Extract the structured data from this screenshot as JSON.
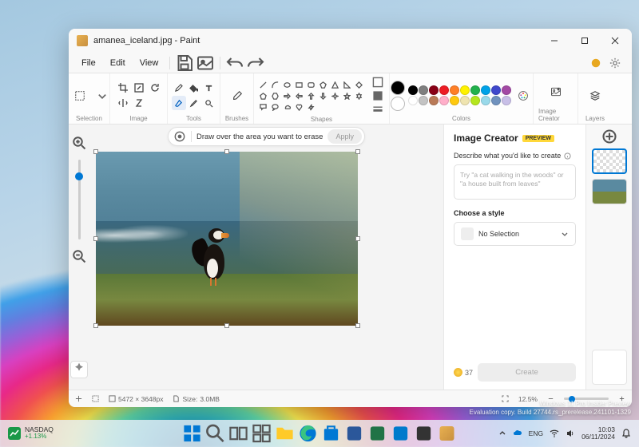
{
  "window": {
    "title": "amanea_iceland.jpg - Paint"
  },
  "menu": {
    "file": "File",
    "edit": "Edit",
    "view": "View"
  },
  "ribbon": {
    "selection": "Selection",
    "image": "Image",
    "tools": "Tools",
    "brushes": "Brushes",
    "shapes": "Shapes",
    "colors": "Colors",
    "image_creator": "Image Creator",
    "layers": "Layers"
  },
  "hint": {
    "text": "Draw over the area you want to erase",
    "apply": "Apply"
  },
  "colors": {
    "primary": "#000000",
    "secondary": "#ffffff",
    "row1": [
      "#000000",
      "#7f7f7f",
      "#880015",
      "#ed1c24",
      "#ff7f27",
      "#fff200",
      "#22b14c",
      "#00a2e8",
      "#3f48cc",
      "#a349a4"
    ],
    "row2": [
      "#ffffff",
      "#c3c3c3",
      "#b97a57",
      "#ffaec9",
      "#ffc90e",
      "#efe4b0",
      "#b5e61d",
      "#99d9ea",
      "#7092be",
      "#c8bfe7"
    ]
  },
  "image_creator": {
    "title": "Image Creator",
    "badge": "PREVIEW",
    "describe": "Describe what you'd like to create",
    "placeholder": "Try \"a cat walking in the woods\" or \"a house built from leaves\"",
    "choose_style": "Choose a style",
    "style_selected": "No Selection",
    "credits": "37",
    "create": "Create"
  },
  "status": {
    "dimensions": "5472 × 3648px",
    "size_label": "Size:",
    "size": "3.0MB",
    "zoom": "12.5%"
  },
  "taskbar": {
    "stock_name": "NASDAQ",
    "stock_change": "+1.13%",
    "lang": "ENG",
    "time": "10:03",
    "date": "06/11/2024"
  },
  "watermark": {
    "line1": "Windows 11 Pro Insider Preview",
    "line2": "Evaluation copy. Build 27744.rs_prerelease.241101-1329"
  }
}
